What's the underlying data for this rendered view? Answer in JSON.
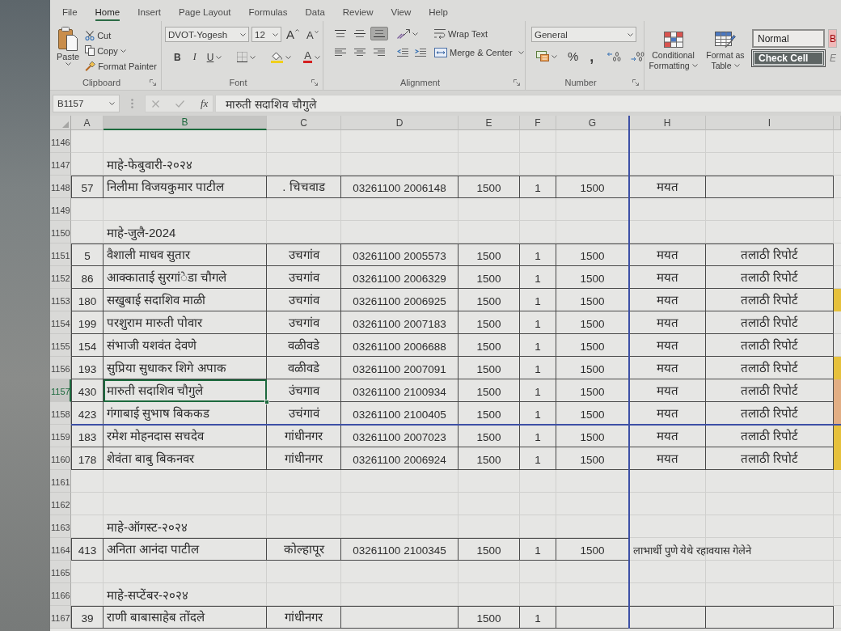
{
  "menu_tabs": [
    {
      "label": "File",
      "selected": false
    },
    {
      "label": "Home",
      "selected": true
    },
    {
      "label": "Insert",
      "selected": false
    },
    {
      "label": "Page Layout",
      "selected": false
    },
    {
      "label": "Formulas",
      "selected": false
    },
    {
      "label": "Data",
      "selected": false
    },
    {
      "label": "Review",
      "selected": false
    },
    {
      "label": "View",
      "selected": false
    },
    {
      "label": "Help",
      "selected": false
    }
  ],
  "ribbon": {
    "clipboard": {
      "title": "Clipboard",
      "paste": "Paste",
      "cut": "Cut",
      "copy": "Copy",
      "format_painter": "Format Painter"
    },
    "font": {
      "title": "Font",
      "font_name": "DVOT-Yogesh",
      "font_size": "12",
      "grow_font": "A",
      "shrink_font": "A",
      "bold": "B",
      "italic": "I",
      "underline": "U",
      "font_color": "A"
    },
    "alignment": {
      "title": "Alignment",
      "vertical": [
        {
          "kind": "top",
          "selected": false
        },
        {
          "kind": "middle",
          "selected": false
        },
        {
          "kind": "bottom",
          "selected": true
        }
      ],
      "horizontal": [
        {
          "kind": "left",
          "selected": false
        },
        {
          "kind": "center",
          "selected": false
        },
        {
          "kind": "right",
          "selected": false
        }
      ],
      "wrap_text": "Wrap Text",
      "merge": "Merge & Center"
    },
    "number": {
      "title": "Number",
      "format": "General",
      "percent": "%",
      "comma": ","
    },
    "styles": {
      "conditional_formatting": "Conditional Formatting",
      "format_as_table": "Format as Table",
      "gallery": [
        {
          "label": "Normal",
          "kind": "normal",
          "selected": true
        },
        {
          "label": "B",
          "kind": "bad",
          "selected": false
        },
        {
          "label": "Check Cell",
          "kind": "check",
          "selected": false
        },
        {
          "label": "E",
          "kind": "explanatory",
          "selected": false
        }
      ]
    }
  },
  "formula_bar": {
    "name_box": "B1157",
    "buttons": [
      {
        "kind": "cancel",
        "disabled": true
      },
      {
        "kind": "enter",
        "disabled": true
      }
    ],
    "function": "fx",
    "formula": "मारुती सदाशिव चौगुले"
  },
  "sheet": {
    "columns": [
      {
        "label": "A",
        "selected": false,
        "page_break_after": false
      },
      {
        "label": "B",
        "selected": true,
        "page_break_after": false
      },
      {
        "label": "C",
        "selected": false,
        "page_break_after": false
      },
      {
        "label": "D",
        "selected": false,
        "page_break_after": false
      },
      {
        "label": "E",
        "selected": false,
        "page_break_after": false
      },
      {
        "label": "F",
        "selected": false,
        "page_break_after": false
      },
      {
        "label": "G",
        "selected": false,
        "page_break_after": true
      },
      {
        "label": "H",
        "selected": false,
        "page_break_after": false
      },
      {
        "label": "I",
        "selected": false,
        "page_break_after": false
      }
    ],
    "rows": [
      {
        "number": "1146",
        "kind": "blank",
        "selected": false,
        "page_break": false
      },
      {
        "number": "1147",
        "kind": "section",
        "selected": false,
        "page_break": false,
        "title": "माहे-फेबुवारी-२०२४"
      },
      {
        "number": "1148",
        "kind": "record",
        "selected": false,
        "page_break": false,
        "cells": {
          "a": "57",
          "b": "निलीमा विजयकुमार पाटील",
          "c": ". चिचवाड",
          "d": "03261100 2006148",
          "e": "1500",
          "f": "1",
          "g": "1500",
          "h": "मयत"
        }
      },
      {
        "number": "1149",
        "kind": "blank",
        "selected": false,
        "page_break": false
      },
      {
        "number": "1150",
        "kind": "section",
        "selected": false,
        "page_break": false,
        "title": "माहे-जुलै-2024"
      },
      {
        "number": "1151",
        "kind": "record",
        "selected": false,
        "page_break": false,
        "cells": {
          "a": "5",
          "b": "वैशाली माधव सुतार",
          "c": "उचगांव",
          "d": "03261100 2005573",
          "e": "1500",
          "f": "1",
          "g": "1500",
          "h": "मयत",
          "i": "तलाठी रिपोर्ट"
        }
      },
      {
        "number": "1152",
        "kind": "record",
        "selected": false,
        "page_break": false,
        "cells": {
          "a": "86",
          "b": "आक्काताई सुरगां◌ेडा चौगले",
          "c": "उचगांव",
          "d": "03261100 2006329",
          "e": "1500",
          "f": "1",
          "g": "1500",
          "h": "मयत",
          "i": "तलाठी रिपोर्ट"
        }
      },
      {
        "number": "1153",
        "kind": "record",
        "selected": false,
        "page_break": false,
        "color": "#e6c13c",
        "cells": {
          "a": "180",
          "b": "सखुबाई सदाशिव माळी",
          "c": "उचगांव",
          "d": "03261100 2006925",
          "e": "1500",
          "f": "1",
          "g": "1500",
          "h": "मयत",
          "i": "तलाठी रिपोर्ट"
        }
      },
      {
        "number": "1154",
        "kind": "record",
        "selected": false,
        "page_break": false,
        "cells": {
          "a": "199",
          "b": "परशुराम मारुती पोवार",
          "c": "उचगांव",
          "d": "03261100 2007183",
          "e": "1500",
          "f": "1",
          "g": "1500",
          "h": "मयत",
          "i": "तलाठी रिपोर्ट"
        }
      },
      {
        "number": "1155",
        "kind": "record",
        "selected": false,
        "page_break": false,
        "cells": {
          "a": "154",
          "b": "संभाजी यशवंत देवणे",
          "c": "वळीवडे",
          "d": "03261100 2006688",
          "e": "1500",
          "f": "1",
          "g": "1500",
          "h": "मयत",
          "i": "तलाठी रिपोर्ट"
        }
      },
      {
        "number": "1156",
        "kind": "record",
        "selected": false,
        "page_break": false,
        "color": "#e6c13c",
        "cells": {
          "a": "193",
          "b": "सुप्रिया सुधाकर शिगे अपाक",
          "c": "वळीवडे",
          "d": "03261100 2007091",
          "e": "1500",
          "f": "1",
          "g": "1500",
          "h": "मयत",
          "i": "तलाठी रिपोर्ट"
        }
      },
      {
        "number": "1157",
        "kind": "record",
        "selected": true,
        "page_break": false,
        "color": "#e2ae84",
        "cells": {
          "a": "430",
          "b": "मारुती सदाशिव चौगुले",
          "c": "उंचगाव",
          "d": "03261100 2100934",
          "e": "1500",
          "f": "1",
          "g": "1500",
          "h": "मयत",
          "i": "तलाठी रिपोर्ट"
        }
      },
      {
        "number": "1158",
        "kind": "record",
        "selected": false,
        "page_break": true,
        "color": "#e2ae84",
        "cells": {
          "a": "423",
          "b": "गंगाबाई सुभाष बिककड",
          "c": "उचंगावं",
          "d": "03261100 2100405",
          "e": "1500",
          "f": "1",
          "g": "1500",
          "h": "मयत",
          "i": "तलाठी रिपोर्ट"
        }
      },
      {
        "number": "1159",
        "kind": "record",
        "selected": false,
        "page_break": false,
        "color": "#e6c13c",
        "cells": {
          "a": "183",
          "b": "रमेश मोहनदास सचदेव",
          "c": "गांधीनगर",
          "d": "03261100 2007023",
          "e": "1500",
          "f": "1",
          "g": "1500",
          "h": "मयत",
          "i": "तलाठी रिपोर्ट"
        }
      },
      {
        "number": "1160",
        "kind": "record",
        "selected": false,
        "page_break": false,
        "color": "#e6c13c",
        "cells": {
          "a": "178",
          "b": "शेवंता बाबु बिकनवर",
          "c": "गांधीनगर",
          "d": "03261100 2006924",
          "e": "1500",
          "f": "1",
          "g": "1500",
          "h": "मयत",
          "i": "तलाठी रिपोर्ट"
        }
      },
      {
        "number": "1161",
        "kind": "blank",
        "selected": false,
        "page_break": false
      },
      {
        "number": "1162",
        "kind": "blank",
        "selected": false,
        "page_break": false
      },
      {
        "number": "1163",
        "kind": "section",
        "selected": false,
        "page_break": false,
        "title": "माहे-ऑगस्ट-२०२४"
      },
      {
        "number": "1164",
        "kind": "note",
        "selected": false,
        "page_break": false,
        "cells": {
          "a": "413",
          "b": "अनिता आनंदा पाटील",
          "c": "कोल्हापूर",
          "d": "03261100 2100345",
          "e": "1500",
          "f": "1",
          "g": "1500"
        },
        "note": "लाभार्थी पुणे येथे रहावयास गेलेने"
      },
      {
        "number": "1165",
        "kind": "blank",
        "selected": false,
        "page_break": false
      },
      {
        "number": "1166",
        "kind": "section",
        "selected": false,
        "page_break": false,
        "title": "माहे-सप्टेंबर-२०२४"
      },
      {
        "number": "1167",
        "kind": "record",
        "selected": false,
        "page_break": false,
        "cells": {
          "a": "39",
          "b": "राणी बाबासाहेब तोंदले",
          "c": "गांधीनगर",
          "e": "1500",
          "f": "1"
        }
      }
    ]
  }
}
